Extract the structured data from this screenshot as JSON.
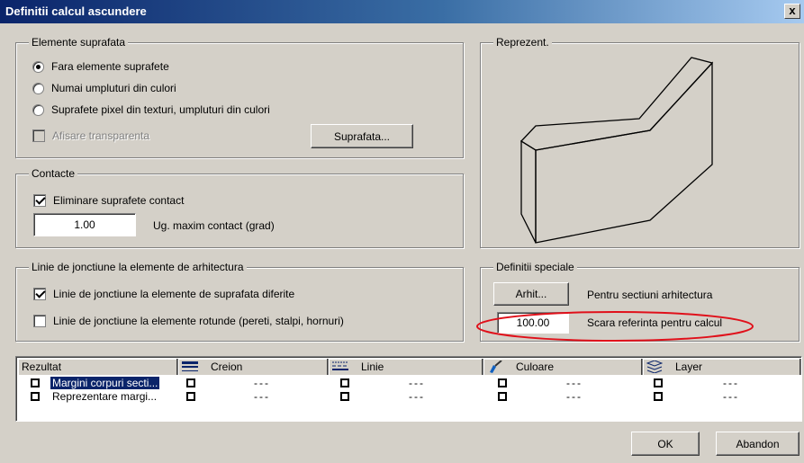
{
  "window": {
    "title": "Definitii calcul ascundere",
    "close_glyph": "x"
  },
  "elemente": {
    "title": "Elemente suprafata",
    "radios": [
      {
        "label": "Fara elemente suprafete",
        "checked": true
      },
      {
        "label": "Numai umpluturi din culori",
        "checked": false
      },
      {
        "label": "Suprafete pixel din texturi, umpluturi din culori",
        "checked": false
      }
    ],
    "transparency_label": "Afisare transparenta",
    "surface_button": "Suprafata..."
  },
  "contacte": {
    "title": "Contacte",
    "remove_label": "Eliminare suprafete contact",
    "remove_checked": true,
    "angle_value": "1.00",
    "angle_label": "Ug. maxim contact (grad)"
  },
  "linie": {
    "title": "Linie de jonctiune la elemente de arhitectura",
    "opt1_label": "Linie de jonctiune la elemente de suprafata diferite",
    "opt1_checked": true,
    "opt2_label": "Linie de jonctiune la elemente rotunde (pereti, stalpi, hornuri)",
    "opt2_checked": false
  },
  "reprezent": {
    "title": "Reprezent."
  },
  "speciale": {
    "title": "Definitii speciale",
    "arhit_button": "Arhit...",
    "arhit_label": "Pentru sectiuni arhitectura",
    "scale_value": "100.00",
    "scale_label": "Scara referinta pentru calcul",
    "highlight_color": "#e0101a"
  },
  "table": {
    "headers": [
      {
        "label": "Rezultat",
        "icon": ""
      },
      {
        "label": "Creion",
        "icon": "pen-lines-icon"
      },
      {
        "label": "Linie",
        "icon": "line-type-icon"
      },
      {
        "label": "Culoare",
        "icon": "paint-brush-icon"
      },
      {
        "label": "Layer",
        "icon": "layers-icon"
      }
    ],
    "rows": [
      {
        "name": "Margini corpuri secti...",
        "selected": true,
        "creion": "---",
        "linie": "---",
        "culoare": "---",
        "layer": "---"
      },
      {
        "name": "Reprezentare margi...",
        "selected": false,
        "creion": "---",
        "linie": "---",
        "culoare": "---",
        "layer": "---"
      }
    ]
  },
  "buttons": {
    "ok": "OK",
    "cancel": "Abandon"
  }
}
